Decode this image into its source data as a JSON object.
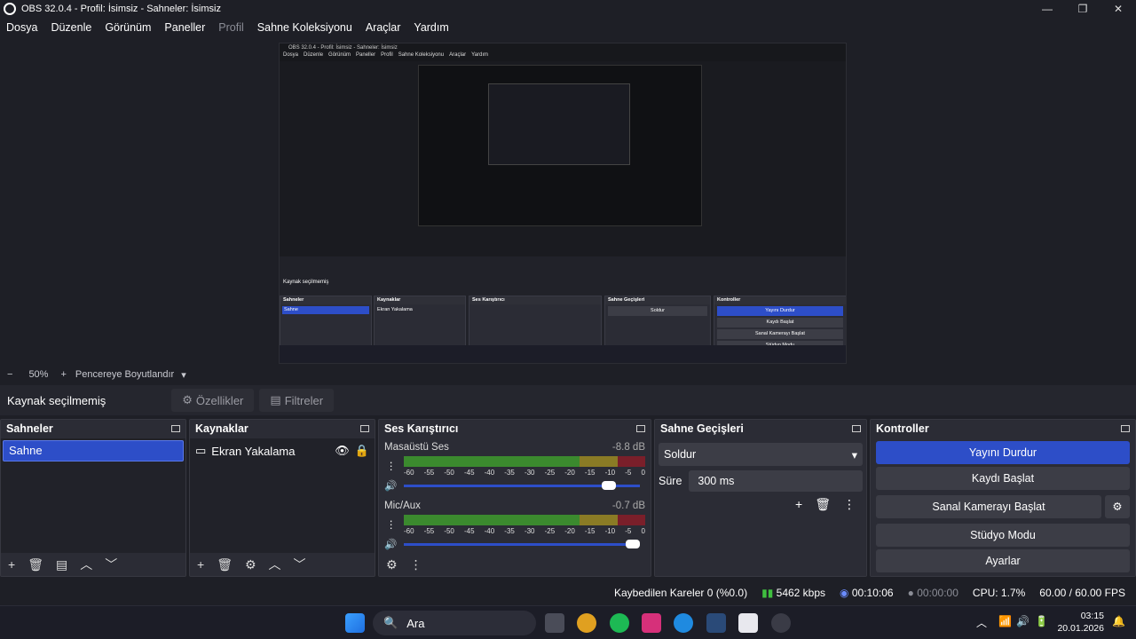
{
  "window": {
    "title": "OBS 32.0.4 - Profil: İsimsiz - Sahneler: İsimsiz"
  },
  "menu": [
    "Dosya",
    "Düzenle",
    "Görünüm",
    "Paneller",
    "Profil",
    "Sahne Koleksiyonu",
    "Araçlar",
    "Yardım"
  ],
  "zoom": {
    "minus": "−",
    "value": "50%",
    "plus": "+",
    "mode": "Pencereye Boyutlandır"
  },
  "source_toolbar": {
    "label": "Kaynak seçilmemiş",
    "properties": "Özellikler",
    "filters": "Filtreler"
  },
  "scenes": {
    "title": "Sahneler",
    "items": [
      "Sahne"
    ]
  },
  "sources": {
    "title": "Kaynaklar",
    "items": [
      "Ekran Yakalama"
    ]
  },
  "mixer": {
    "title": "Ses Karıştırıcı",
    "ticks": [
      "-60",
      "-55",
      "-50",
      "-45",
      "-40",
      "-35",
      "-30",
      "-25",
      "-20",
      "-15",
      "-10",
      "-5",
      "0"
    ],
    "channels": [
      {
        "name": "Masaüstü Ses",
        "db": "-8.8 dB",
        "volume": 0.9
      },
      {
        "name": "Mic/Aux",
        "db": "-0.7 dB",
        "volume": 1.0
      }
    ]
  },
  "transitions": {
    "title": "Sahne Geçişleri",
    "selected": "Soldur",
    "duration_label": "Süre",
    "duration": "300 ms"
  },
  "controls": {
    "title": "Kontroller",
    "buttons": [
      "Yayını Durdur",
      "Kaydı Başlat",
      "Sanal Kamerayı Başlat",
      "Stüdyo Modu",
      "Ayarlar"
    ]
  },
  "status": {
    "dropped": "Kaybedilen Kareler 0 (%0.0)",
    "bitrate": "5462 kbps",
    "stream_time": "00:10:06",
    "rec_time": "00:00:00",
    "cpu": "CPU: 1.7%",
    "fps": "60.00 / 60.00 FPS"
  },
  "taskbar": {
    "search": "Ara",
    "time": "03:15",
    "date": "20.01.2026"
  },
  "colors": {
    "accent": "#2d4ec8",
    "bg": "#1e1f26",
    "dock": "#2b2c35"
  }
}
